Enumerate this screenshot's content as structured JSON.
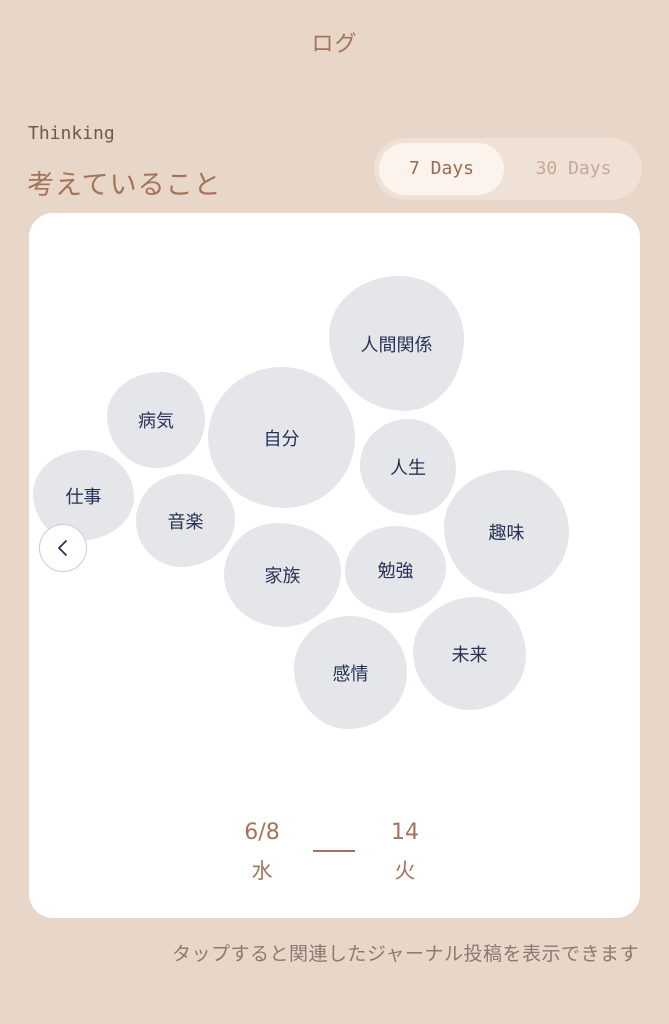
{
  "header": {
    "title": "ログ"
  },
  "section": {
    "title_en": "Thinking",
    "title_ja": "考えていること"
  },
  "range_toggle": {
    "option_7": "7 Days",
    "option_30": "30 Days",
    "selected": "7 Days"
  },
  "topics": [
    {
      "label": "人間関係"
    },
    {
      "label": "病気"
    },
    {
      "label": "自分"
    },
    {
      "label": "人生"
    },
    {
      "label": "仕事"
    },
    {
      "label": "音楽"
    },
    {
      "label": "趣味"
    },
    {
      "label": "家族"
    },
    {
      "label": "勉強"
    },
    {
      "label": "未来"
    },
    {
      "label": "感情"
    }
  ],
  "nav": {
    "prev_icon": "chevron-left-icon"
  },
  "date_range": {
    "start_date": "6/8",
    "start_weekday": "水",
    "end_date": "14",
    "end_weekday": "火"
  },
  "footer": {
    "hint": "タップすると関連したジャーナル投稿を表示できます"
  },
  "colors": {
    "background": "#e8d6c8",
    "accent": "#a5735a",
    "bubble": "#e5e6e9",
    "bubble_text": "#283256",
    "card": "#ffffff"
  }
}
